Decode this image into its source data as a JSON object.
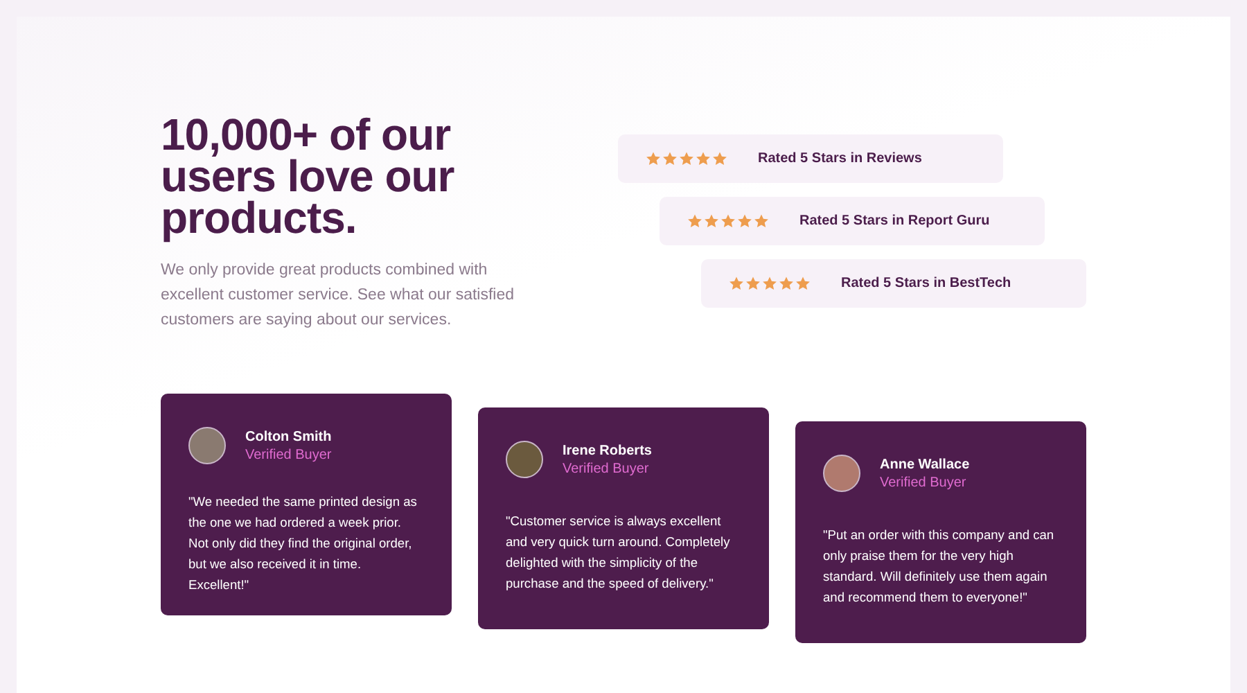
{
  "heading": "10,000+ of our users love our products.",
  "description": "We only provide great products combined with excellent customer service. See what our satisfied customers are saying about our services.",
  "ratings": [
    {
      "stars": 5,
      "label": "Rated 5 Stars in Reviews"
    },
    {
      "stars": 5,
      "label": "Rated 5 Stars in Report Guru"
    },
    {
      "stars": 5,
      "label": "Rated 5 Stars in BestTech"
    }
  ],
  "testimonials": [
    {
      "name": "Colton Smith",
      "role": "Verified Buyer",
      "quote": "\"We needed the same printed design as the one we had ordered a week prior. Not only did they find the original order, but we also received it in time. Excellent!\""
    },
    {
      "name": "Irene Roberts",
      "role": "Verified Buyer",
      "quote": "\"Customer service is always excellent and very quick turn around. Completely delighted with the simplicity of the purchase and the speed of delivery.\""
    },
    {
      "name": "Anne Wallace",
      "role": "Verified Buyer",
      "quote": "\"Put an order with this company and can only praise them for the very high standard. Will definitely use them again and recommend them to everyone!\""
    }
  ]
}
